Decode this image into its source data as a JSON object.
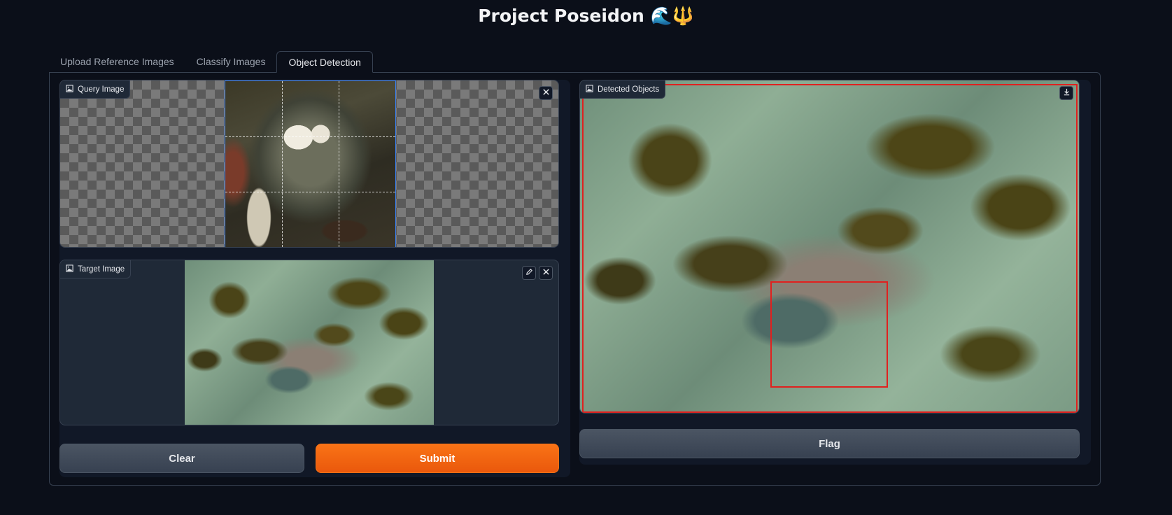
{
  "app": {
    "title": "Project Poseidon 🌊🔱"
  },
  "tabs": [
    {
      "label": "Upload Reference Images",
      "active": false
    },
    {
      "label": "Classify Images",
      "active": false
    },
    {
      "label": "Object Detection",
      "active": true
    }
  ],
  "query_image": {
    "label": "Query Image",
    "label_icon": "image-icon",
    "actions": [
      "close-icon"
    ]
  },
  "target_image": {
    "label": "Target Image",
    "label_icon": "image-icon",
    "actions": [
      "edit-icon",
      "close-icon"
    ]
  },
  "detected_objects": {
    "label": "Detected Objects",
    "label_icon": "image-icon",
    "actions": [
      "download-icon"
    ],
    "box_color": "#e0211f"
  },
  "buttons": {
    "clear_label": "Clear",
    "submit_label": "Submit",
    "flag_label": "Flag"
  },
  "colors": {
    "background": "#0b0f19",
    "panel": "#111827",
    "accent": "#f97316",
    "crop_border": "#3b82f6"
  }
}
